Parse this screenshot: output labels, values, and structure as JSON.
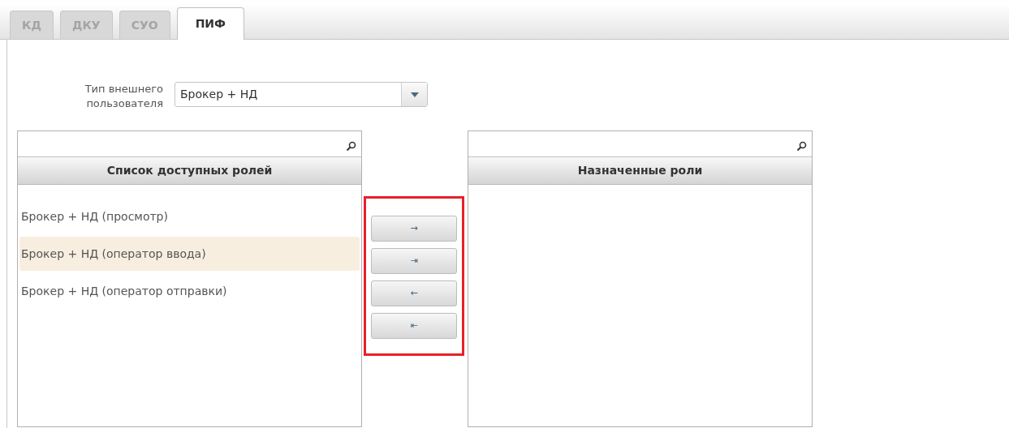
{
  "tabs": [
    {
      "label": "КД",
      "selected": false
    },
    {
      "label": "ДКУ",
      "selected": false
    },
    {
      "label": "СУО",
      "selected": false
    },
    {
      "label": "ПИФ",
      "selected": true
    }
  ],
  "user_type": {
    "label": "Тип внешнего пользователя",
    "value": "Брокер + НД"
  },
  "available": {
    "header": "Список доступных ролей",
    "items": [
      {
        "label": "Брокер + НД (просмотр)",
        "selected": false
      },
      {
        "label": "Брокер + НД (оператор ввода)",
        "selected": true
      },
      {
        "label": "Брокер + НД (оператор отправки)",
        "selected": false
      }
    ]
  },
  "move_buttons": {
    "highlighted": true,
    "buttons": [
      "→",
      "⇥",
      "←",
      "⇤"
    ]
  },
  "assigned": {
    "header": "Назначенные роли"
  }
}
